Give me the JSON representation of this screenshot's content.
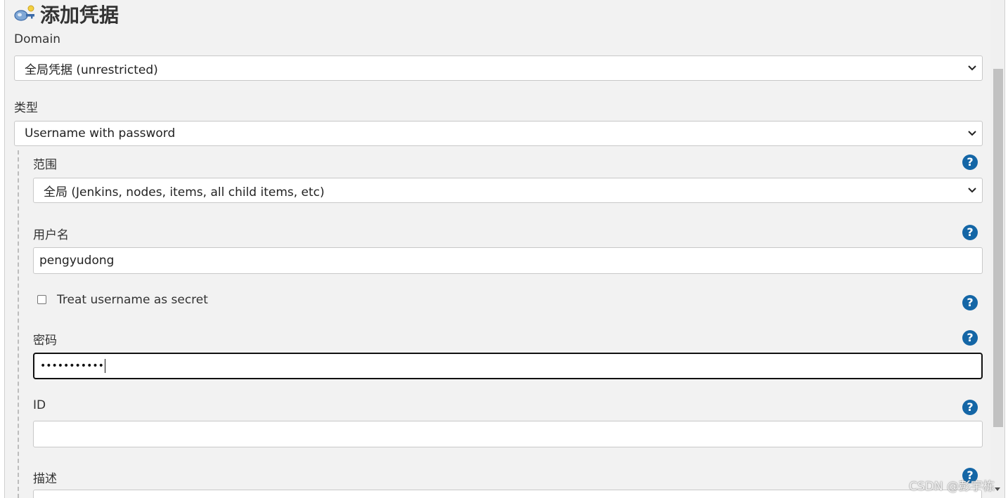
{
  "dialog": {
    "title": "添加凭据",
    "title_icon": "credentials-key-icon"
  },
  "domain": {
    "label": "Domain",
    "selected": "全局凭据 (unrestricted)"
  },
  "kind": {
    "label": "类型",
    "selected": "Username with password"
  },
  "scope": {
    "label": "范围",
    "selected": "全局 (Jenkins, nodes, items, all child items, etc)"
  },
  "username": {
    "label": "用户名",
    "value": "pengyudong"
  },
  "username_secret": {
    "label": "Treat username as secret",
    "checked": false
  },
  "password": {
    "label": "密码",
    "masked_value": "•••••••••••"
  },
  "id_field": {
    "label": "ID",
    "value": ""
  },
  "description": {
    "label": "描述"
  },
  "help_icon_glyph": "?",
  "watermark": "CSDN @彭宇栋",
  "colors": {
    "help_icon": "#1466a6",
    "dialog_bg": "#f2f2f2",
    "input_border": "#c8c8c8",
    "focused_border": "#111111"
  }
}
